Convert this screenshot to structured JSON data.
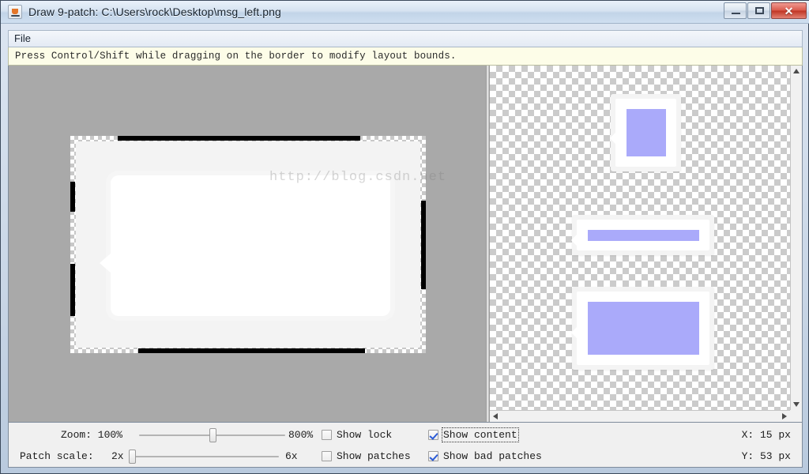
{
  "window": {
    "title": "Draw 9-patch: C:\\Users\\rock\\Desktop\\msg_left.png",
    "app_icon": "java-coffee-cup-icon",
    "buttons": {
      "minimize": "minimize-icon",
      "maximize": "maximize-icon",
      "close": "✕"
    }
  },
  "menubar": {
    "items": [
      {
        "label": "File"
      }
    ]
  },
  "infobar": {
    "message": "Press Control/Shift while dragging on the border to modify layout bounds."
  },
  "canvas": {
    "watermark": "http://blog.csdn.net"
  },
  "controls": {
    "zoom": {
      "label": "Zoom: 100%",
      "min_label": "100%",
      "max_label": "800%",
      "value_percent": 50
    },
    "patch_scale": {
      "label": "Patch scale:",
      "min_label": "2x",
      "max_label": "6x",
      "value_percent": 2
    },
    "checkboxes": [
      {
        "name": "show-lock",
        "label": "Show lock",
        "checked": false,
        "focused": false
      },
      {
        "name": "show-patches",
        "label": "Show patches",
        "checked": false,
        "focused": false
      },
      {
        "name": "show-content",
        "label": "Show content",
        "checked": true,
        "focused": true
      },
      {
        "name": "show-bad-patches",
        "label": "Show bad patches",
        "checked": true,
        "focused": false
      }
    ],
    "cursor": {
      "x_label": "X: 15 px",
      "y_label": "Y: 53 px"
    }
  },
  "colors": {
    "content_fill": "#aaaafa",
    "canvas_background": "#a9a9a9",
    "info_background": "#fdfde8",
    "checker": "#cbcbcb"
  }
}
